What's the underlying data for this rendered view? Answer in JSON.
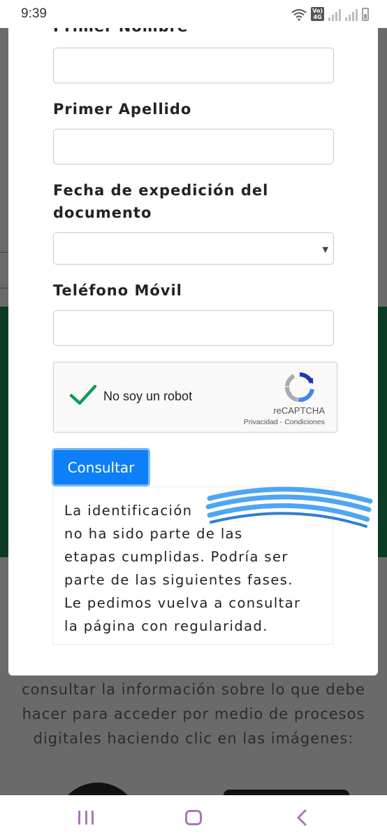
{
  "status_bar": {
    "time": "9:39",
    "network_badge_top": "Vo)",
    "network_badge_bottom": "4G",
    "icons": [
      "wifi-icon",
      "signal-icon",
      "signal-icon",
      "battery-icon"
    ]
  },
  "form": {
    "fields": [
      {
        "label": "Primer Nombre",
        "value": ""
      },
      {
        "label": "Primer Apellido",
        "value": ""
      },
      {
        "label_line1": "Fecha de expedición del",
        "label_line2": "documento",
        "value": ""
      },
      {
        "label": "Teléfono Móvil",
        "value": ""
      }
    ],
    "recaptcha": {
      "label": "No soy un robot",
      "checked": true,
      "brand": "reCAPTCHA",
      "links": "Privacidad - Condiciones"
    },
    "submit_label": "Consultar",
    "result": {
      "line1": "La identificación",
      "line2": "no ha sido parte de las",
      "line3": "etapas cumplidas. Podría ser",
      "line4": "parte de las siguientes fases.",
      "line5": "Le pedimos vuelva a consultar",
      "line6": "la página con regularidad."
    }
  },
  "background_page": {
    "line1": "consultar la información sobre lo que debe",
    "line2": "hacer para acceder por medio de procesos",
    "line3": "digitales haciendo clic en las imágenes:"
  },
  "colors": {
    "button": "#0d7ff8",
    "check": "#0f9d58",
    "nav_icons": "#a678b3",
    "redaction": "#4fa6f0"
  }
}
